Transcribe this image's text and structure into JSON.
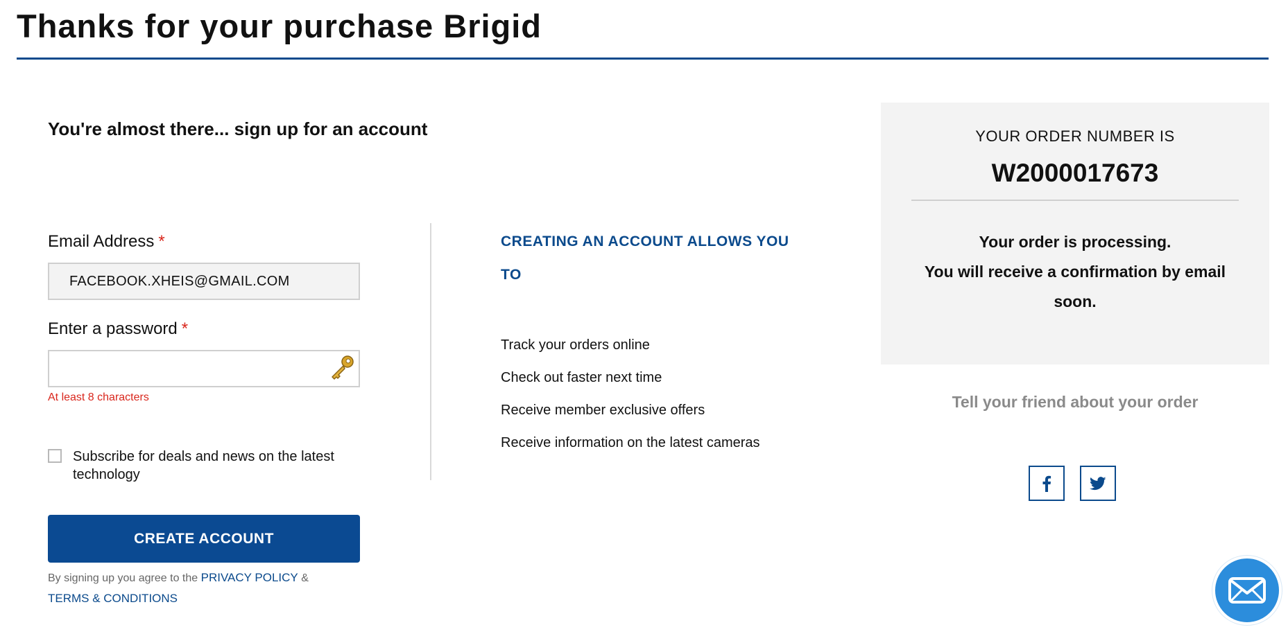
{
  "header": {
    "title": "Thanks for your purchase Brigid"
  },
  "signup": {
    "heading": "You're almost there... sign up for an account",
    "email_label": "Email Address",
    "required_mark": "*",
    "email_value": "FACEBOOK.XHEIS@GMAIL.COM",
    "password_label": "Enter a password",
    "password_value": "",
    "password_hint": "At least 8 characters",
    "subscribe_label": "Subscribe for deals and news on the latest technology",
    "subscribe_checked": false,
    "create_button": "CREATE ACCOUNT",
    "legal_prefix": "By signing up you agree to the",
    "privacy_link": "PRIVACY POLICY",
    "legal_and": "&",
    "terms_link": "TERMS & CONDITIONS"
  },
  "benefits": {
    "heading": "CREATING AN ACCOUNT ALLOWS YOU TO",
    "items": [
      "Track your orders online",
      "Check out faster next time",
      "Receive member exclusive offers",
      "Receive information on the latest cameras"
    ]
  },
  "order": {
    "label": "YOUR ORDER NUMBER IS",
    "number": "W2000017673",
    "status_line1": "Your order is processing.",
    "status_line2": "You will receive a confirmation by email soon."
  },
  "share": {
    "heading": "Tell your friend about your order",
    "icons": [
      "facebook-icon",
      "twitter-icon"
    ]
  },
  "chat": {
    "icon": "envelope-icon"
  },
  "colors": {
    "brand_blue": "#0b4a92",
    "error_red": "#d9261c",
    "panel_grey": "#f3f3f3",
    "chat_blue": "#2c8ddc"
  }
}
